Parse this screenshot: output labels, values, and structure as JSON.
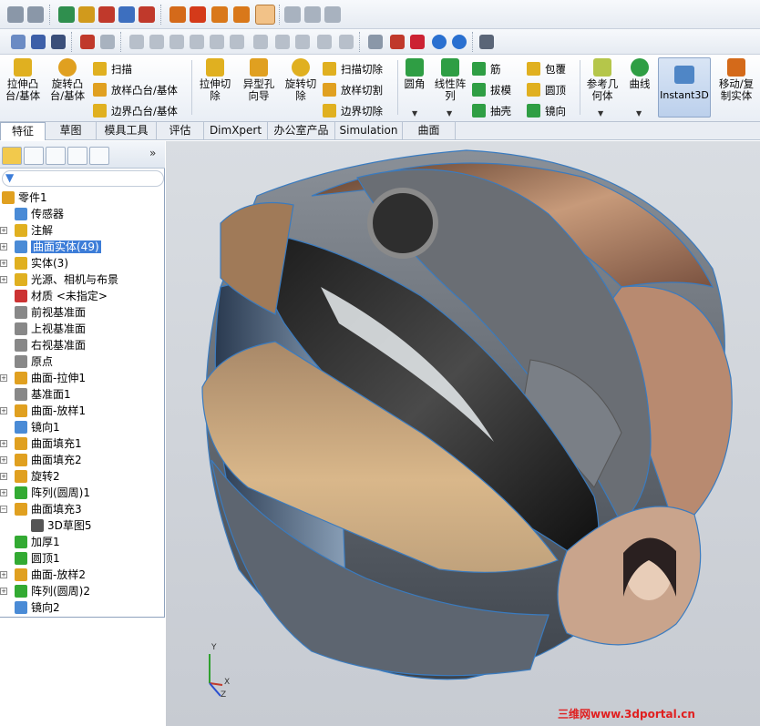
{
  "ribbon": {
    "extrude_boss": "拉伸凸\n台/基体",
    "revolve_boss": "旋转凸\n台/基体",
    "sweep": "扫描",
    "loft_boss": "放样凸台/基体",
    "boundary_boss": "边界凸台/基体",
    "extrude_cut": "拉伸切\n除",
    "hole_wizard": "异型孔\n向导",
    "revolve_cut": "旋转切\n除",
    "sweep_cut": "扫描切除",
    "loft_cut": "放样切割",
    "boundary_cut": "边界切除",
    "fillet": "圆角",
    "linear_pattern": "线性阵\n列",
    "rib": "筋",
    "draft": "拔模",
    "shell": "抽壳",
    "wrap": "包覆",
    "dome": "圆顶",
    "mirror": "镜向",
    "ref_geometry": "参考几\n何体",
    "curves": "曲线",
    "instant3d": "Instant3D",
    "move_copy": "移动/复\n制实体"
  },
  "tabs": [
    "特征",
    "草图",
    "模具工具",
    "评估",
    "DimXpert",
    "办公室产品",
    "Simulation",
    "曲面"
  ],
  "tree": {
    "root": "零件1",
    "items": [
      {
        "label": "传感器",
        "icon": "sensor-icon",
        "color": "#4a8bd6",
        "expand": false
      },
      {
        "label": "注解",
        "icon": "annotation-icon",
        "color": "#e0b020",
        "expand": true
      },
      {
        "label": "曲面实体(49)",
        "icon": "surface-bodies-icon",
        "color": "#4a8bd6",
        "expand": true,
        "selected": true
      },
      {
        "label": "实体(3)",
        "icon": "solid-bodies-icon",
        "color": "#e0b020",
        "expand": true
      },
      {
        "label": "光源、相机与布景",
        "icon": "lights-icon",
        "color": "#e0b020",
        "expand": true
      },
      {
        "label": "材质 <未指定>",
        "icon": "material-icon",
        "color": "#c33",
        "expand": false
      },
      {
        "label": "前视基准面",
        "icon": "plane-icon",
        "color": "#888",
        "expand": false
      },
      {
        "label": "上视基准面",
        "icon": "plane-icon",
        "color": "#888",
        "expand": false
      },
      {
        "label": "右视基准面",
        "icon": "plane-icon",
        "color": "#888",
        "expand": false
      },
      {
        "label": "原点",
        "icon": "origin-icon",
        "color": "#888",
        "expand": false
      },
      {
        "label": "曲面-拉伸1",
        "icon": "surface-extrude-icon",
        "color": "#e0a020",
        "expand": true
      },
      {
        "label": "基准面1",
        "icon": "plane-icon",
        "color": "#888",
        "expand": false
      },
      {
        "label": "曲面-放样1",
        "icon": "surface-loft-icon",
        "color": "#e0a020",
        "expand": true
      },
      {
        "label": "镜向1",
        "icon": "mirror-icon",
        "color": "#4a8bd6",
        "expand": false
      },
      {
        "label": "曲面填充1",
        "icon": "surface-fill-icon",
        "color": "#e0a020",
        "expand": true
      },
      {
        "label": "曲面填充2",
        "icon": "surface-fill-icon",
        "color": "#e0a020",
        "expand": true
      },
      {
        "label": "旋转2",
        "icon": "revolve-icon",
        "color": "#e0a020",
        "expand": true
      },
      {
        "label": "阵列(圆周)1",
        "icon": "circular-pattern-icon",
        "color": "#3a3",
        "expand": true
      },
      {
        "label": "曲面填充3",
        "icon": "surface-fill-icon",
        "color": "#e0a020",
        "expand": "open"
      },
      {
        "label": "3D草图5",
        "icon": "sketch3d-icon",
        "color": "#555",
        "expand": false,
        "indent": 1
      },
      {
        "label": "加厚1",
        "icon": "thicken-icon",
        "color": "#3a3",
        "expand": false
      },
      {
        "label": "圆顶1",
        "icon": "dome-icon",
        "color": "#3a3",
        "expand": false
      },
      {
        "label": "曲面-放样2",
        "icon": "surface-loft-icon",
        "color": "#e0a020",
        "expand": true
      },
      {
        "label": "阵列(圆周)2",
        "icon": "circular-pattern-icon",
        "color": "#3a3",
        "expand": true
      },
      {
        "label": "镜向2",
        "icon": "mirror-icon",
        "color": "#4a8bd6",
        "expand": false
      }
    ]
  },
  "triad": {
    "x": "X",
    "y": "Y",
    "z": "Z"
  },
  "watermark": "三维网www.3dportal.cn",
  "colors": {
    "accent": "#3d7dd8",
    "panel_border": "#8ea2bd",
    "viewport_bg": "#cfd3d9"
  }
}
